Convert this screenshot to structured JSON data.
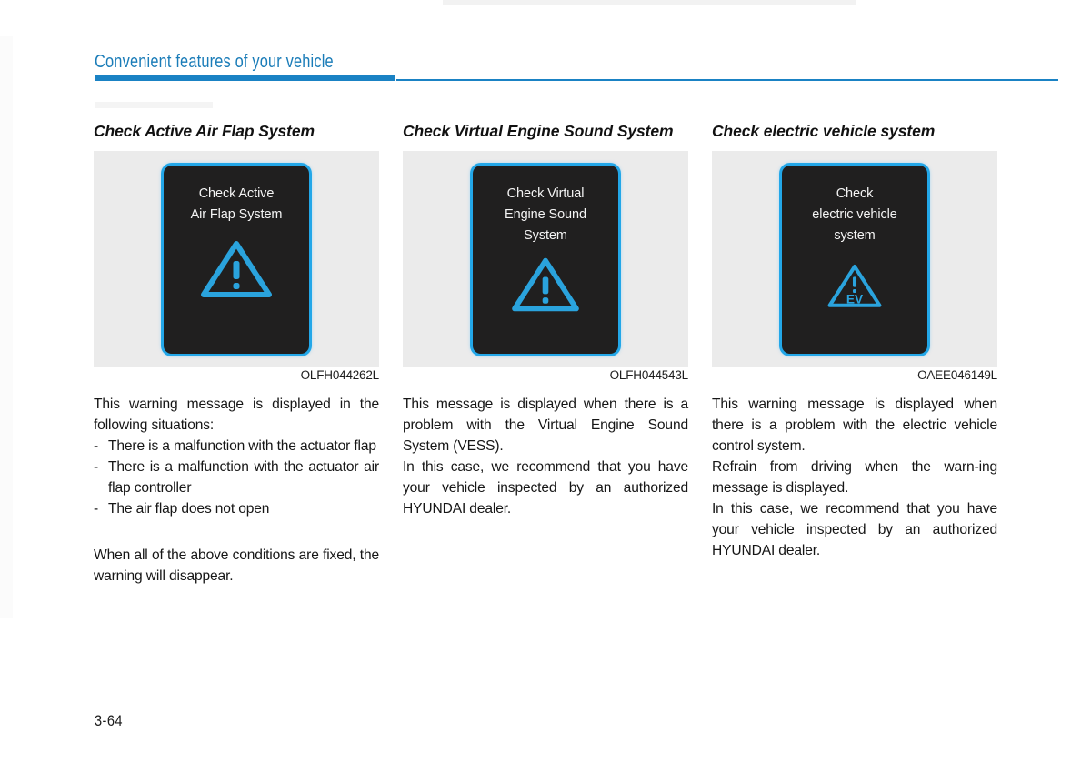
{
  "header": {
    "title": "Convenient features of your vehicle"
  },
  "footer": {
    "page_number": "3-64"
  },
  "colors": {
    "header_blue": "#1a82c4",
    "title_blue": "#1a7cb8",
    "screen_border_blue": "#23a7e8",
    "icon_blue": "#2aa3dd",
    "screen_background": "#201f1f",
    "figure_background": "#ebebeb",
    "body_text": "#161616"
  },
  "columns": [
    {
      "heading": "Check Active Air Flap System",
      "figure": {
        "caption": "OLFH044262L",
        "screen_message": "Check Active\nAir Flap System",
        "icon": "warning-triangle-exclamation-icon"
      },
      "intro": "This warning message is displayed in the following situations:",
      "bullets": [
        "There is a malfunction with the actuator flap",
        "There is a malfunction with the actuator air flap controller",
        "The air flap does not open"
      ],
      "closing": "When all of the above conditions are fixed, the warning will disappear."
    },
    {
      "heading": "Check Virtual Engine Sound System",
      "figure": {
        "caption": "OLFH044543L",
        "screen_message": "Check Virtual\nEngine Sound\nSystem",
        "icon": "warning-triangle-exclamation-icon"
      },
      "paragraphs": [
        "This message is displayed when there is a problem with the Virtual Engine Sound System (VESS).",
        "In this case, we recommend that you have your vehicle inspected by an authorized HYUNDAI dealer."
      ]
    },
    {
      "heading": "Check electric vehicle system",
      "figure": {
        "caption": "OAEE046149L",
        "screen_message": "Check\nelectric vehicle\nsystem",
        "icon": "warning-triangle-ev-icon",
        "icon_label": "EV"
      },
      "paragraphs": [
        "This warning message is displayed when there is a problem with the electric vehicle control system.",
        "Refrain from driving when the warn-ing message is displayed.",
        "In this case, we recommend that you have your vehicle inspected by an authorized HYUNDAI dealer."
      ]
    }
  ]
}
